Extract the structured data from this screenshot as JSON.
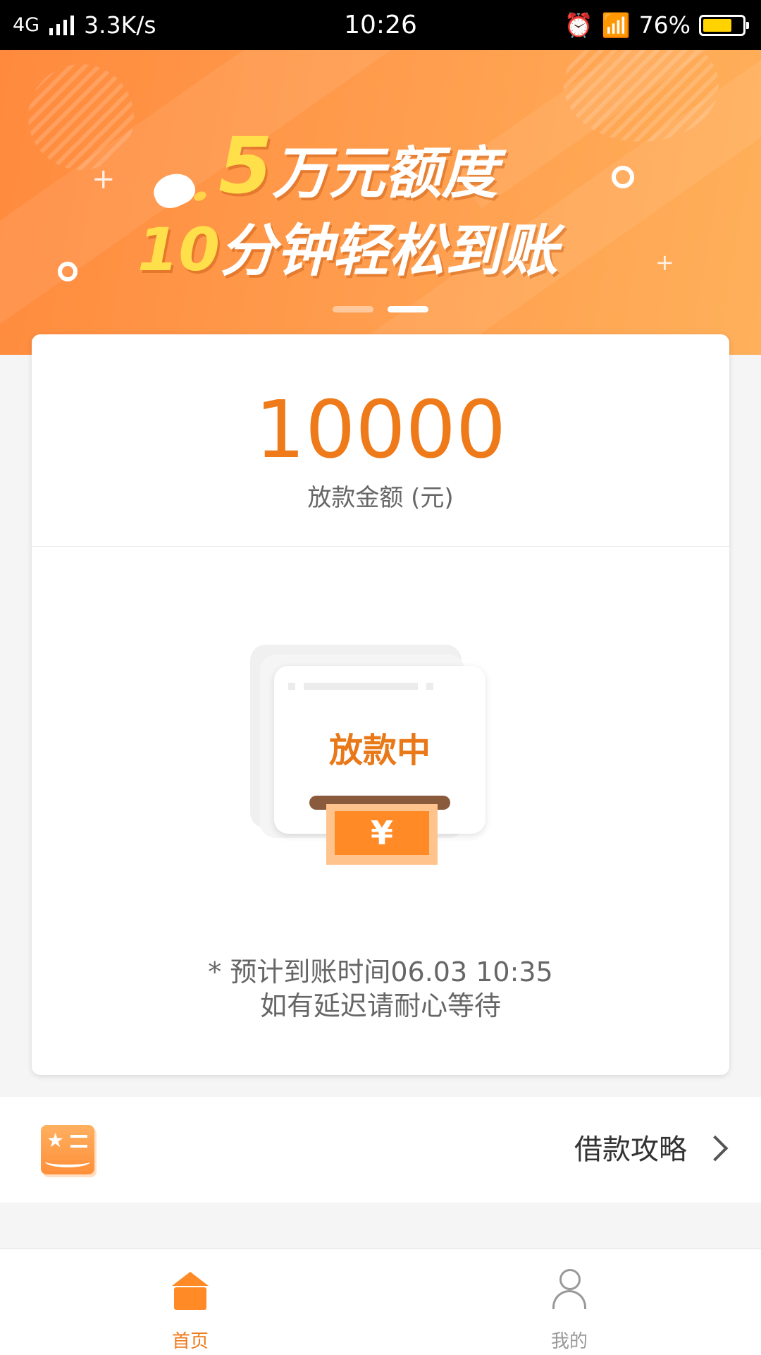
{
  "status_bar": {
    "network": "4G",
    "speed": "3.3K/s",
    "time": "10:26",
    "battery": "76%",
    "battery_level": 0.76
  },
  "banner": {
    "line1_number": "5",
    "line1_text": "万元额度",
    "line2_number": "10",
    "line2_text": "分钟轻松到账",
    "page_count": 2,
    "active_page": 2
  },
  "loan": {
    "amount": "10000",
    "amount_label": "放款金额 (元)",
    "status": "放款中",
    "currency_symbol": "¥",
    "eta_line": "* 预计到账时间06.03 10:35",
    "delay_note": "如有延迟请耐心等待"
  },
  "guide": {
    "label": "借款攻略"
  },
  "tabbar": {
    "home_label": "首页",
    "mine_label": "我的"
  },
  "colors": {
    "accent": "#ee7a1a",
    "banner_orange": "#ff9b4c",
    "status_bar_bg": "#000000"
  }
}
